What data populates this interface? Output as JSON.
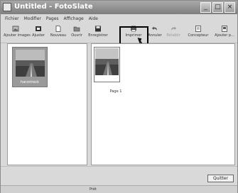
{
  "window": {
    "title": "Untitled - FotoSlate",
    "minimize_glyph": "_",
    "maximize_glyph": "□",
    "close_glyph": "×"
  },
  "menu": [
    "Fichier",
    "Modifier",
    "Pages",
    "Affichage",
    "Aide"
  ],
  "toolbar": {
    "buttons": [
      {
        "label": "Ajouter images",
        "icon": "add-images-icon"
      },
      {
        "label": "Ajuster",
        "icon": "adjust-icon"
      },
      {
        "label": "Nouveau",
        "icon": "new-icon"
      },
      {
        "label": "Ouvrir",
        "icon": "open-icon"
      },
      {
        "label": "Enregistrer",
        "icon": "save-icon"
      },
      {
        "label": "Imprimer",
        "icon": "print-icon"
      },
      {
        "label": "Annuler",
        "icon": "undo-icon"
      },
      {
        "label": "Rétablir",
        "icon": "redo-icon",
        "disabled": true
      },
      {
        "label": "Concepteur",
        "icon": "designer-icon"
      },
      {
        "label": "Ajouter p...",
        "icon": "add-page-icon"
      }
    ]
  },
  "left_panel": {
    "image_label": "harzstreck"
  },
  "right_panel": {
    "page_label": "Page 1"
  },
  "quit_label": "Quitter",
  "status": "Prêt",
  "colors": {
    "titlebar": "#8f8f8f",
    "highlight": "#000000",
    "thumb_bg": "#9a9a9a"
  }
}
